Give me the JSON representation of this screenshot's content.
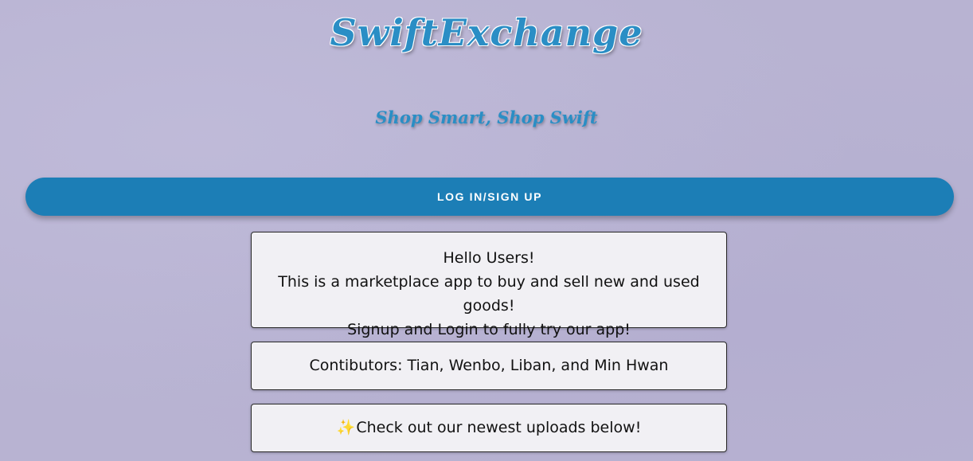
{
  "brand": {
    "title": "SwiftExchange",
    "tagline": "Shop Smart, Shop Swift"
  },
  "auth": {
    "button_label": "LOG IN/SIGN UP"
  },
  "intro_card": {
    "greeting": "Hello Users!",
    "description": "This is a marketplace app to buy and sell new and used goods!",
    "call_to_action": "Signup and Login to fully try our app!"
  },
  "contributors_card": {
    "text": "Contibutors: Tian, Wenbo, Liban, and Min Hwan"
  },
  "uploads_card": {
    "icon": "sparkle-icon",
    "text": "Check out our newest uploads below!"
  },
  "colors": {
    "background": "#b8b3d2",
    "brand_accent": "#2a8ec5",
    "button": "#1c7eb6",
    "card_background": "#f1f0f4"
  }
}
